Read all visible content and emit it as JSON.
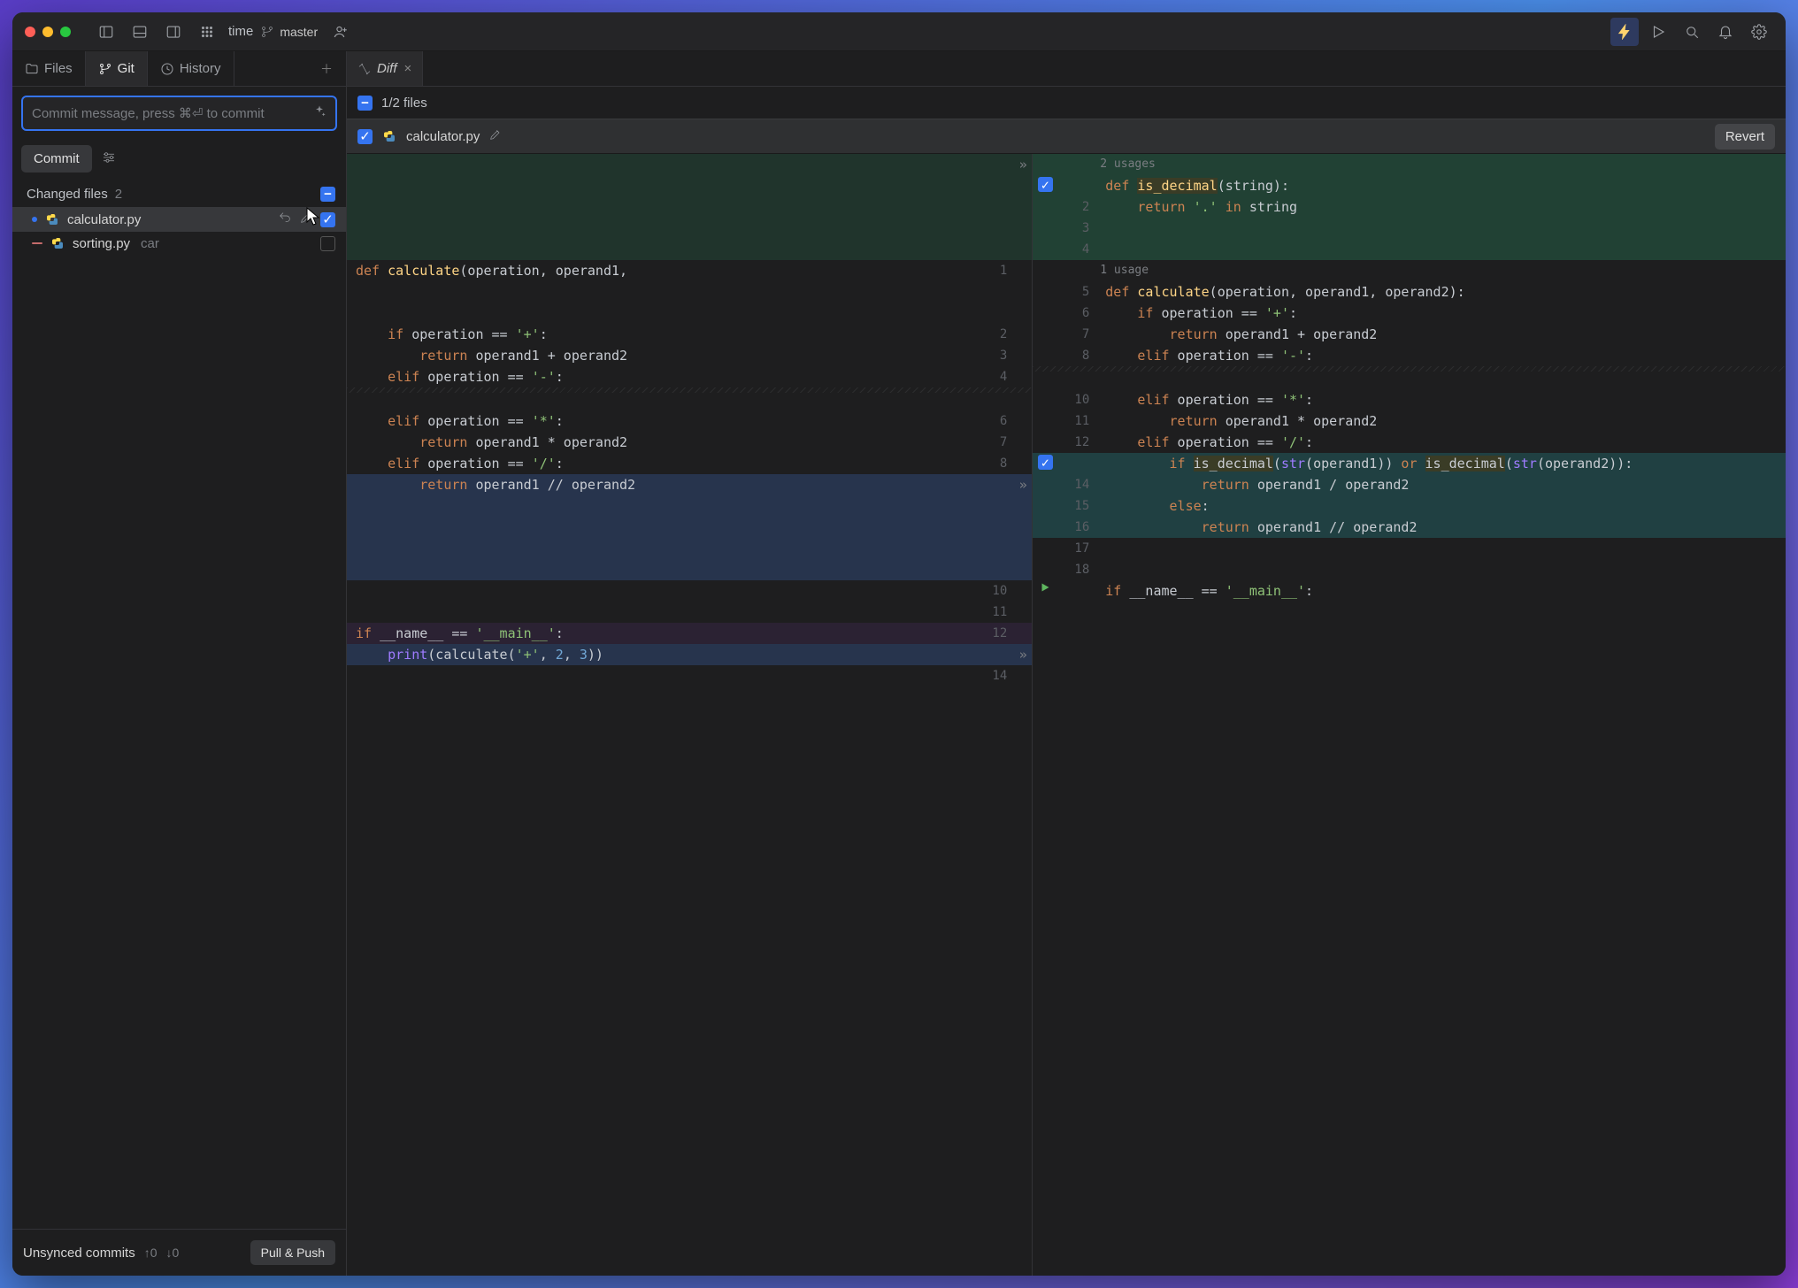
{
  "titlebar": {
    "project": "time",
    "branch": "master"
  },
  "leftTabs": {
    "files": "Files",
    "git": "Git",
    "history": "History"
  },
  "commit": {
    "placeholder": "Commit message, press ⌘⏎ to commit",
    "button": "Commit"
  },
  "changed": {
    "label": "Changed files",
    "count": "2",
    "files": [
      {
        "name": "calculator.py",
        "status": "modified",
        "checked": true,
        "tag": ""
      },
      {
        "name": "sorting.py",
        "status": "deleted",
        "checked": false,
        "tag": "car"
      }
    ]
  },
  "unsynced": {
    "label": "Unsynced commits",
    "up": "↑0",
    "down": "↓0",
    "button": "Pull & Push"
  },
  "editorTab": {
    "label": "Diff"
  },
  "diffHeader": {
    "files": "1/2 files"
  },
  "diffFile": {
    "name": "calculator.py",
    "revert": "Revert"
  },
  "left": {
    "l1": "def calculate(operation, operand1,",
    "l2": "    if operation == '+':",
    "l3": "        return operand1 + operand2",
    "l4": "    elif operation == '-':",
    "l6": "    elif operation == '*':",
    "l7": "        return operand1 * operand2",
    "l8": "    elif operation == '/':",
    "l9": "        return operand1 // operand2",
    "l12": "if __name__ == '__main__':",
    "l13": "    print(calculate('+', 2, 3))"
  },
  "right": {
    "u2": "2 usages",
    "r1": "def is_decimal(string):",
    "r2": "    return '.' in string",
    "u1": "1 usage",
    "r5": "def calculate(operation, operand1, operand2):",
    "r6": "    if operation == '+':",
    "r7": "        return operand1 + operand2",
    "r8": "    elif operation == '-':",
    "r10": "    elif operation == '*':",
    "r11": "        return operand1 * operand2",
    "r12": "    elif operation == '/':",
    "r13a": "        if is_decimal(str(operand1)) or is_decimal(str(operand2)):",
    "r14": "            return operand1 / operand2",
    "r15": "        else:",
    "r16": "            return operand1 // operand2",
    "r19": "if __name__ == '__main__':"
  },
  "lineNumsL": {
    "n1": "1",
    "n2": "2",
    "n3": "3",
    "n4": "4",
    "n6": "6",
    "n7": "7",
    "n8": "8",
    "n10": "10",
    "n11": "11",
    "n12": "12",
    "n14": "14"
  },
  "lineNumsR": {
    "n2": "2",
    "n3": "3",
    "n4": "4",
    "n5": "5",
    "n6": "6",
    "n7": "7",
    "n8": "8",
    "n10": "10",
    "n11": "11",
    "n12": "12",
    "n14": "14",
    "n15": "15",
    "n16": "16",
    "n17": "17",
    "n18": "18"
  },
  "colors": {
    "accent": "#3574f0",
    "addBg": "#214134",
    "delBg": "#2b2233"
  }
}
